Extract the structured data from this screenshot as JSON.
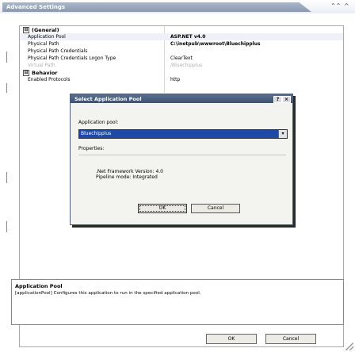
{
  "window": {
    "title": "Advanced Settings",
    "collapse_icon": "double-chevron-up-icon",
    "close_icon": "caret-up-icon"
  },
  "grid": {
    "categories": [
      {
        "label": "(General)",
        "toggle": "⊟",
        "properties": [
          {
            "name": "Application Pool",
            "value": "ASP.NET v4.0",
            "bold": true
          },
          {
            "name": "Physical Path",
            "value": "C:\\inetpub\\wwwroot\\Bluechipplus",
            "bold": true
          },
          {
            "name": "Physical Path Credentials",
            "value": ""
          },
          {
            "name": "Physical Path Credentials Logon Type",
            "value": "ClearText"
          },
          {
            "name": "Virtual Path",
            "value": "/Bluechipplus",
            "dim": true
          }
        ]
      },
      {
        "label": "Behavior",
        "toggle": "⊟",
        "properties": [
          {
            "name": "Enabled Protocols",
            "value": "http"
          }
        ]
      }
    ]
  },
  "dialog": {
    "title": "Select Application Pool",
    "help_icon": "?",
    "close_icon": "×",
    "app_pool_label": "Application pool:",
    "selected_pool": "Bluechipplus",
    "properties_label": "Properties:",
    "framework_line": ".Net Framework Version: 4.0",
    "pipeline_line": "Pipeline mode: Integrated",
    "ok_label": "OK",
    "cancel_label": "Cancel"
  },
  "description": {
    "title": "Application Pool",
    "text": "[applicationPool] Configures this application to run in the specified application pool."
  },
  "footer": {
    "ok_label": "OK",
    "cancel_label": "Cancel"
  },
  "colors": {
    "title_bar": "#8c9ab0",
    "dialog_title": "#3e5273",
    "combo_selected": "#1f48a8"
  }
}
